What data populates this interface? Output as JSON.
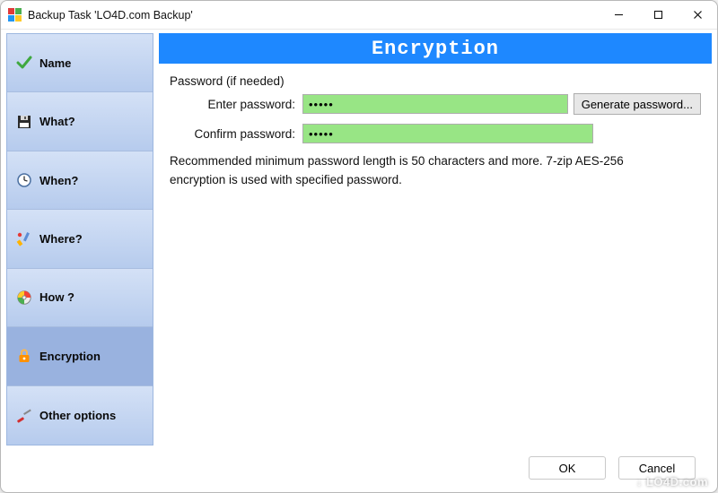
{
  "window": {
    "title": "Backup Task 'LO4D.com Backup'"
  },
  "sidebar": {
    "items": [
      {
        "label": "Name"
      },
      {
        "label": "What?"
      },
      {
        "label": "When?"
      },
      {
        "label": "Where?"
      },
      {
        "label": "How ?"
      },
      {
        "label": "Encryption"
      },
      {
        "label": "Other options"
      }
    ],
    "active_index": 5
  },
  "page": {
    "title": "Encryption",
    "section_label": "Password (if needed)",
    "enter_label": "Enter password:",
    "confirm_label": "Confirm password:",
    "enter_value": "•••••",
    "confirm_value": "•••••",
    "generate_label": "Generate password...",
    "info": "Recommended minimum password length is 50 characters and more. 7-zip AES-256 encryption is used with specified password."
  },
  "footer": {
    "ok": "OK",
    "cancel": "Cancel"
  },
  "colors": {
    "accent": "#1e88ff",
    "sidebar": "#bdd0f2",
    "field_bg": "#98e585"
  },
  "watermark": "↓ LO4D.com"
}
